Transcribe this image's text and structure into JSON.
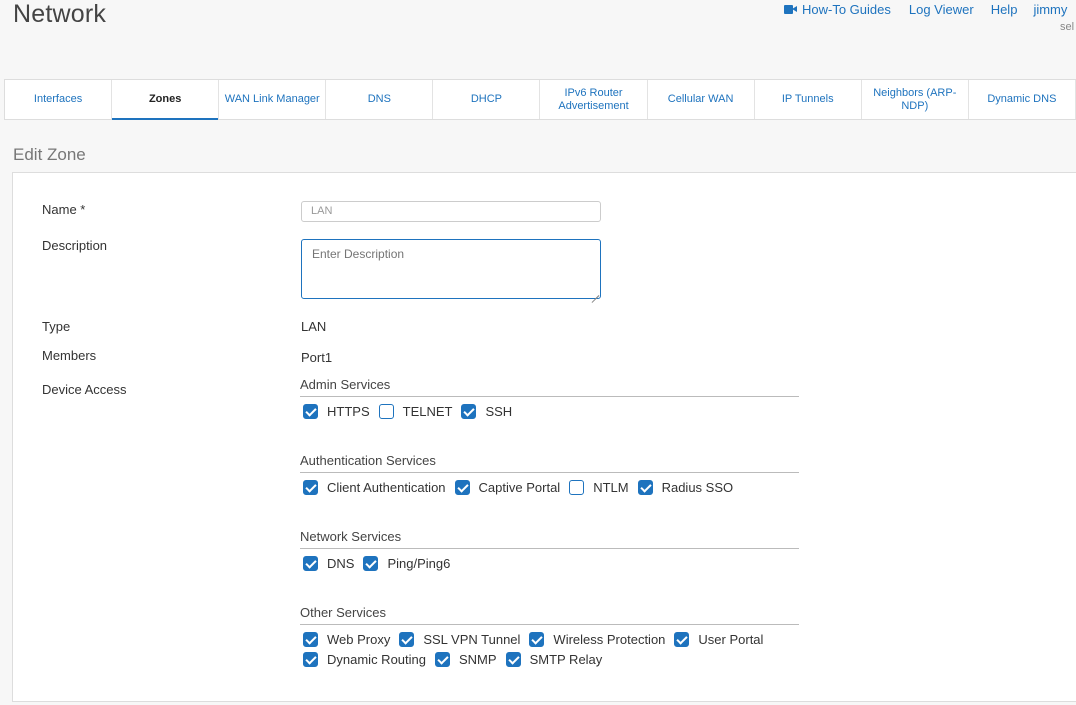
{
  "page": {
    "title": "Network"
  },
  "top_links": {
    "howto": "How-To Guides",
    "log_viewer": "Log Viewer",
    "help": "Help",
    "user": "jimmy",
    "sub": "sel"
  },
  "tabs": [
    {
      "label": "Interfaces",
      "active": false
    },
    {
      "label": "Zones",
      "active": true
    },
    {
      "label": "WAN Link Manager",
      "active": false
    },
    {
      "label": "DNS",
      "active": false
    },
    {
      "label": "DHCP",
      "active": false
    },
    {
      "label": "IPv6 Router Advertisement",
      "active": false
    },
    {
      "label": "Cellular WAN",
      "active": false
    },
    {
      "label": "IP Tunnels",
      "active": false
    },
    {
      "label": "Neighbors (ARP-NDP)",
      "active": false
    },
    {
      "label": "Dynamic DNS",
      "active": false
    }
  ],
  "section_title": "Edit Zone",
  "form": {
    "name_label": "Name *",
    "name_value": "LAN",
    "description_label": "Description",
    "description_placeholder": "Enter Description",
    "type_label": "Type",
    "type_value": "LAN",
    "members_label": "Members",
    "members_value": "Port1",
    "device_access_label": "Device Access"
  },
  "groups": {
    "admin": {
      "title": "Admin Services",
      "items": [
        {
          "label": "HTTPS",
          "checked": true
        },
        {
          "label": "TELNET",
          "checked": false
        },
        {
          "label": "SSH",
          "checked": true
        }
      ]
    },
    "auth": {
      "title": "Authentication Services",
      "items": [
        {
          "label": "Client Authentication",
          "checked": true
        },
        {
          "label": "Captive Portal",
          "checked": true
        },
        {
          "label": "NTLM",
          "checked": false
        },
        {
          "label": "Radius SSO",
          "checked": true
        }
      ]
    },
    "network": {
      "title": "Network Services",
      "items": [
        {
          "label": "DNS",
          "checked": true
        },
        {
          "label": "Ping/Ping6",
          "checked": true
        }
      ]
    },
    "other": {
      "title": "Other Services",
      "items": [
        {
          "label": "Web Proxy",
          "checked": true
        },
        {
          "label": "SSL VPN Tunnel",
          "checked": true
        },
        {
          "label": "Wireless Protection",
          "checked": true
        },
        {
          "label": "User Portal",
          "checked": true
        },
        {
          "label": "Dynamic Routing",
          "checked": true
        },
        {
          "label": "SNMP",
          "checked": true
        },
        {
          "label": "SMTP Relay",
          "checked": true
        }
      ]
    }
  },
  "colors": {
    "accent": "#1e73be",
    "background": "#f7f7f7"
  }
}
